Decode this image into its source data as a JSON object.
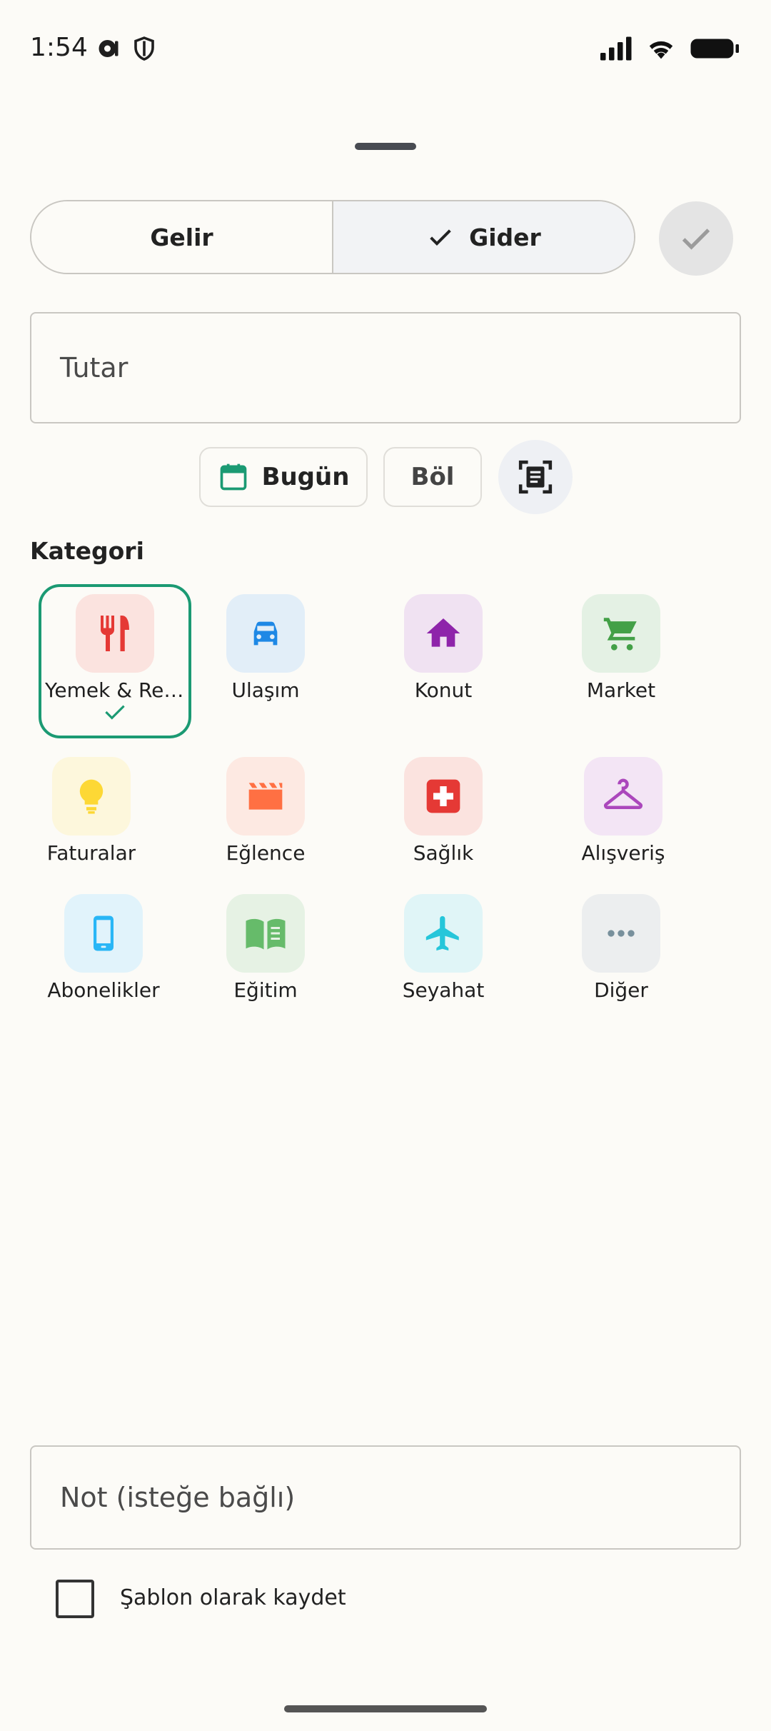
{
  "status": {
    "time": "1:54"
  },
  "toggle": {
    "income_label": "Gelir",
    "expense_label": "Gider",
    "selected": "expense"
  },
  "amount": {
    "placeholder": "Tutar"
  },
  "actions": {
    "date_label": "Bugün",
    "split_label": "Böl"
  },
  "categories": {
    "title": "Kategori",
    "selected": "Yemek & Restoran",
    "items": [
      {
        "label": "Yemek & Restoran",
        "icon": "fork-knife-icon",
        "color": "#e53935",
        "bg": "#fbe3df"
      },
      {
        "label": "Ulaşım",
        "icon": "car-icon",
        "color": "#1e88e5",
        "bg": "#e2eef8"
      },
      {
        "label": "Konut",
        "icon": "home-icon",
        "color": "#8e24aa",
        "bg": "#f0e2f2"
      },
      {
        "label": "Market",
        "icon": "cart-icon",
        "color": "#43a047",
        "bg": "#e4f1e4"
      },
      {
        "label": "Faturalar",
        "icon": "lightbulb-icon",
        "color": "#fdd835",
        "bg": "#fdf7dc"
      },
      {
        "label": "Eğlence",
        "icon": "clapperboard-icon",
        "color": "#ff7043",
        "bg": "#fde9e2"
      },
      {
        "label": "Sağlık",
        "icon": "medical-icon",
        "color": "#e53935",
        "bg": "#fbe3df"
      },
      {
        "label": "Alışveriş",
        "icon": "hanger-icon",
        "color": "#ab47bc",
        "bg": "#f3e5f5"
      },
      {
        "label": "Abonelikler",
        "icon": "phone-icon",
        "color": "#29b6f6",
        "bg": "#e1f3fb"
      },
      {
        "label": "Eğitim",
        "icon": "book-icon",
        "color": "#66bb6a",
        "bg": "#e6f2e4"
      },
      {
        "label": "Seyahat",
        "icon": "airplane-icon",
        "color": "#26c6da",
        "bg": "#e0f5f7"
      },
      {
        "label": "Diğer",
        "icon": "more-dots-icon",
        "color": "#78909c",
        "bg": "#eceeef"
      }
    ]
  },
  "note": {
    "placeholder": "Not (isteğe bağlı)"
  },
  "template": {
    "label": "Şablon olarak kaydet",
    "checked": false
  },
  "colors": {
    "accent": "#1b9a73",
    "background": "#fcfbf7"
  }
}
